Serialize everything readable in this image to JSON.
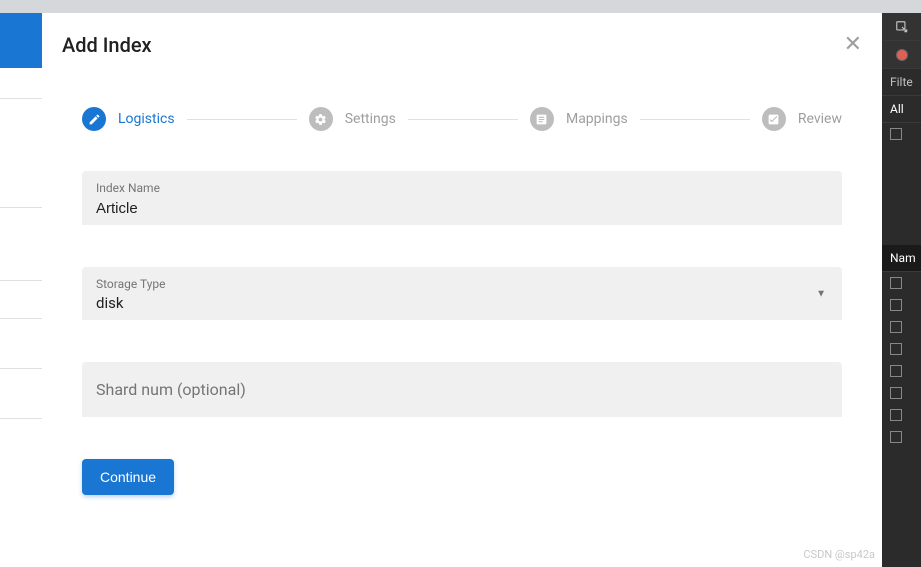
{
  "modal": {
    "title": "Add Index",
    "close_label": "✕"
  },
  "stepper": {
    "step1": {
      "label": "Logistics"
    },
    "step2": {
      "label": "Settings"
    },
    "step3": {
      "label": "Mappings"
    },
    "step4": {
      "label": "Review"
    }
  },
  "form": {
    "index_name": {
      "label": "Index Name",
      "value": "Article"
    },
    "storage_type": {
      "label": "Storage Type",
      "value": "disk"
    },
    "shard_num": {
      "placeholder": "Shard num (optional)"
    },
    "continue_label": "Continue"
  },
  "dark_panel": {
    "filter_label": "Filte",
    "all_label": "All",
    "name_label": "Nam"
  },
  "watermark": "CSDN @sp42a"
}
